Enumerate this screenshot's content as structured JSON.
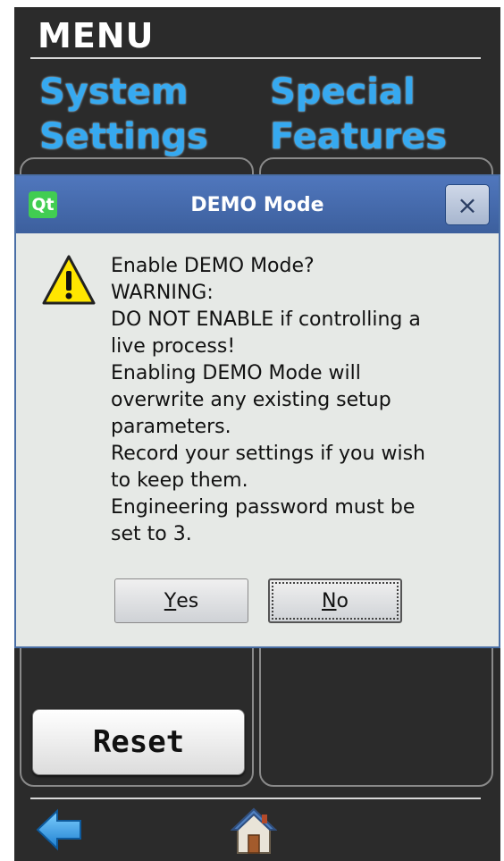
{
  "header": {
    "title": "MENU"
  },
  "columns": [
    {
      "line1": "System",
      "line2": "Settings"
    },
    {
      "line1": "Special",
      "line2": "Features"
    }
  ],
  "reset_button": {
    "label": "Reset"
  },
  "footer": {
    "back_icon": "back-arrow-icon",
    "home_icon": "home-icon"
  },
  "dialog": {
    "title": "DEMO Mode",
    "app_icon_text": "Qt",
    "close_glyph": "×",
    "message_lines": [
      "Enable DEMO Mode?",
      "WARNING:",
      "DO NOT ENABLE if controlling a",
      "live process!",
      "Enabling DEMO Mode will",
      "overwrite any existing setup",
      "parameters.",
      "Record your settings if you wish",
      "to keep them.",
      "Engineering password must be",
      "set to 3."
    ],
    "yes_mnemonic": "Y",
    "yes_rest": "es",
    "no_mnemonic": "N",
    "no_rest": "o"
  },
  "colors": {
    "background": "#2b2b2b",
    "accent": "#36a9f0",
    "dialog_title": "#4a6fa6",
    "dialog_body": "#e6e9e6"
  }
}
